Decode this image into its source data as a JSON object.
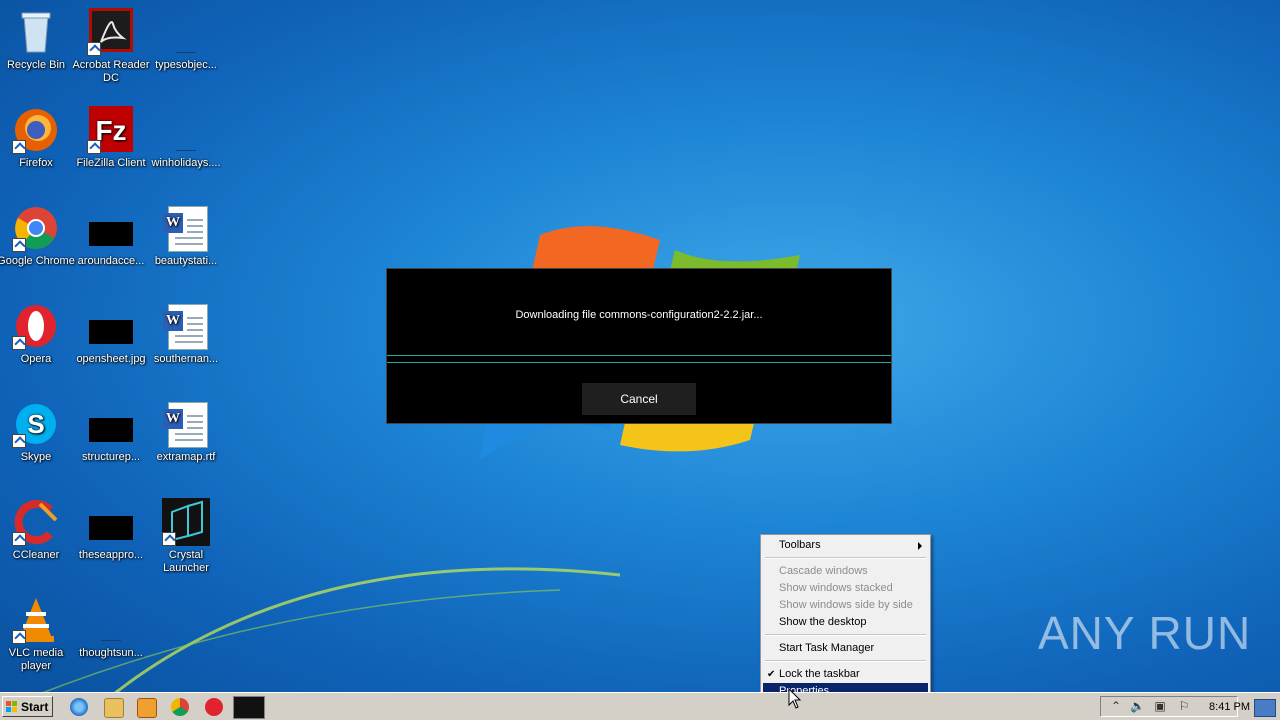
{
  "desktop": {
    "icons": [
      {
        "label": "Recycle Bin"
      },
      {
        "label": "Acrobat Reader DC"
      },
      {
        "label": "typesobjec..."
      },
      {
        "label": "Firefox"
      },
      {
        "label": "FileZilla Client"
      },
      {
        "label": "winholidays...."
      },
      {
        "label": "Google Chrome"
      },
      {
        "label": "aroundacce..."
      },
      {
        "label": "beautystati..."
      },
      {
        "label": "Opera"
      },
      {
        "label": "opensheet.jpg"
      },
      {
        "label": "southernan..."
      },
      {
        "label": "Skype"
      },
      {
        "label": "structurep..."
      },
      {
        "label": "extramap.rtf"
      },
      {
        "label": "CCleaner"
      },
      {
        "label": "theseappro..."
      },
      {
        "label": "Crystal Launcher"
      },
      {
        "label": "VLC media player"
      },
      {
        "label": "thoughtsun..."
      }
    ]
  },
  "dialog": {
    "message": "Downloading file commons-configuration2-2.2.jar...",
    "cancel_label": "Cancel"
  },
  "context_menu": {
    "items": [
      {
        "label": "Toolbars"
      },
      {
        "label": "Cascade windows"
      },
      {
        "label": "Show windows stacked"
      },
      {
        "label": "Show windows side by side"
      },
      {
        "label": "Show the desktop"
      },
      {
        "label": "Start Task Manager"
      },
      {
        "label": "Lock the taskbar"
      },
      {
        "label": "Properties"
      }
    ]
  },
  "taskbar": {
    "start_label": "Start",
    "clock": "8:41 PM"
  },
  "watermark": "ANY RUN",
  "colors": {
    "menu_highlight": "#0a246a",
    "progress_accent": "#2aa5a5",
    "desktop_blue": "#1e86d6"
  }
}
